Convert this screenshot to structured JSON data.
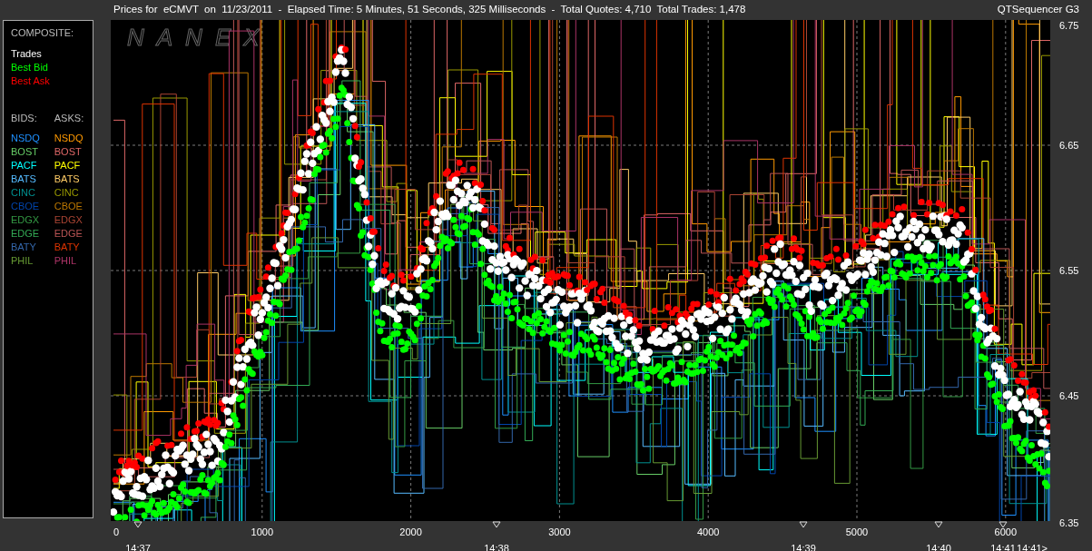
{
  "header": {
    "title": "Prices for  eCMVT  on  11/23/2011  -  Elapsed Time: 5 Minutes, 51 Seconds, 325 Milliseconds  -  Total Quotes: 4,710  Total Trades: 1,478",
    "app_name": "QTSequencer G3"
  },
  "legend": {
    "composite_heading": "COMPOSITE:",
    "composite": [
      {
        "label": "Trades",
        "color": "#ffffff"
      },
      {
        "label": "Best Bid",
        "color": "#00ff00"
      },
      {
        "label": "Best Ask",
        "color": "#ff0000"
      }
    ],
    "bids_heading": "BIDS:",
    "asks_heading": "ASKS:",
    "bids": [
      {
        "label": "NSDQ",
        "color": "#1e90ff"
      },
      {
        "label": "BOST",
        "color": "#66cc66"
      },
      {
        "label": "PACF",
        "color": "#00ffff"
      },
      {
        "label": "BATS",
        "color": "#55bbff"
      },
      {
        "label": "CINC",
        "color": "#009090"
      },
      {
        "label": "CBOE",
        "color": "#0044aa"
      },
      {
        "label": "EDGX",
        "color": "#339944"
      },
      {
        "label": "EDGE",
        "color": "#33aa55"
      },
      {
        "label": "BATY",
        "color": "#3366aa"
      },
      {
        "label": "PHIL",
        "color": "#669933"
      }
    ],
    "asks": [
      {
        "label": "NSDQ",
        "color": "#ff9900"
      },
      {
        "label": "BOST",
        "color": "#dd6666"
      },
      {
        "label": "PACF",
        "color": "#ffff00"
      },
      {
        "label": "BATS",
        "color": "#ffcc66"
      },
      {
        "label": "CINC",
        "color": "#999900"
      },
      {
        "label": "CBOE",
        "color": "#bb7700"
      },
      {
        "label": "EDGX",
        "color": "#aa4433"
      },
      {
        "label": "EDGE",
        "color": "#bb5555"
      },
      {
        "label": "BATY",
        "color": "#dd3300"
      },
      {
        "label": "PHIL",
        "color": "#aa3366"
      }
    ]
  },
  "chart": {
    "watermark": "NANEX",
    "price_labels": [
      "6.75",
      "6.65",
      "6.55",
      "6.45",
      "6.35"
    ],
    "count_labels": [
      "0",
      "1000",
      "2000",
      "3000",
      "4000",
      "5000",
      "6000"
    ],
    "time_labels": [
      "14:37",
      "14:38",
      "14:39",
      "14:40",
      "14:41",
      "14:41>"
    ]
  }
}
